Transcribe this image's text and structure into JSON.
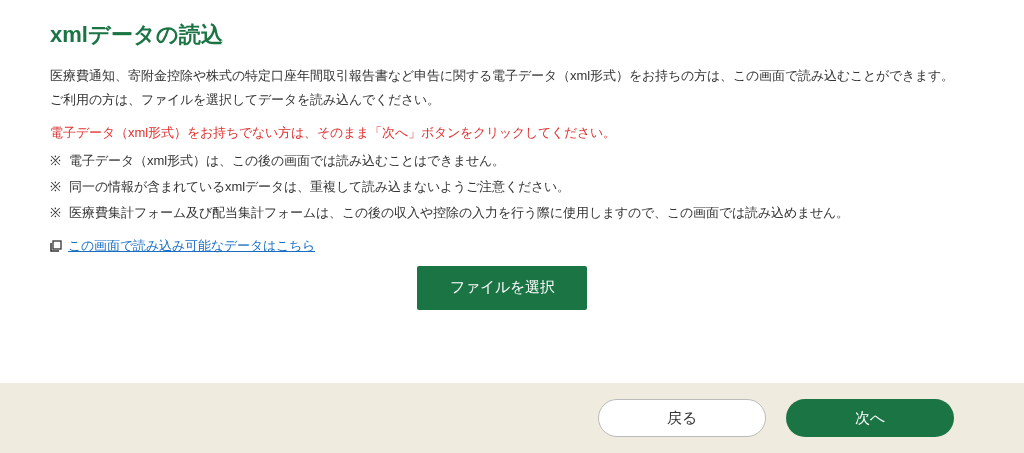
{
  "title": "xmlデータの読込",
  "intro": [
    "医療費通知、寄附金控除や株式の特定口座年間取引報告書など申告に関する電子データ（xml形式）をお持ちの方は、この画面で読み込むことができます。",
    "ご利用の方は、ファイルを選択してデータを読み込んでください。"
  ],
  "warning": "電子データ（xml形式）をお持ちでない方は、そのまま「次へ」ボタンをクリックしてください。",
  "notes": [
    {
      "mark": "※",
      "text": "電子データ（xml形式）は、この後の画面では読み込むことはできません。"
    },
    {
      "mark": "※",
      "text": "同一の情報が含まれているxmlデータは、重複して読み込まないようご注意ください。"
    },
    {
      "mark": "※",
      "text": "医療費集計フォーム及び配当集計フォームは、この後の収入や控除の入力を行う際に使用しますので、この画面では読み込めません。"
    }
  ],
  "link": "この画面で読み込み可能なデータはこちら",
  "file_button": "ファイルを選択",
  "footer_buttons": [
    {
      "label": "戻る",
      "kind": "secondary"
    },
    {
      "label": "次へ",
      "kind": "primary"
    }
  ]
}
